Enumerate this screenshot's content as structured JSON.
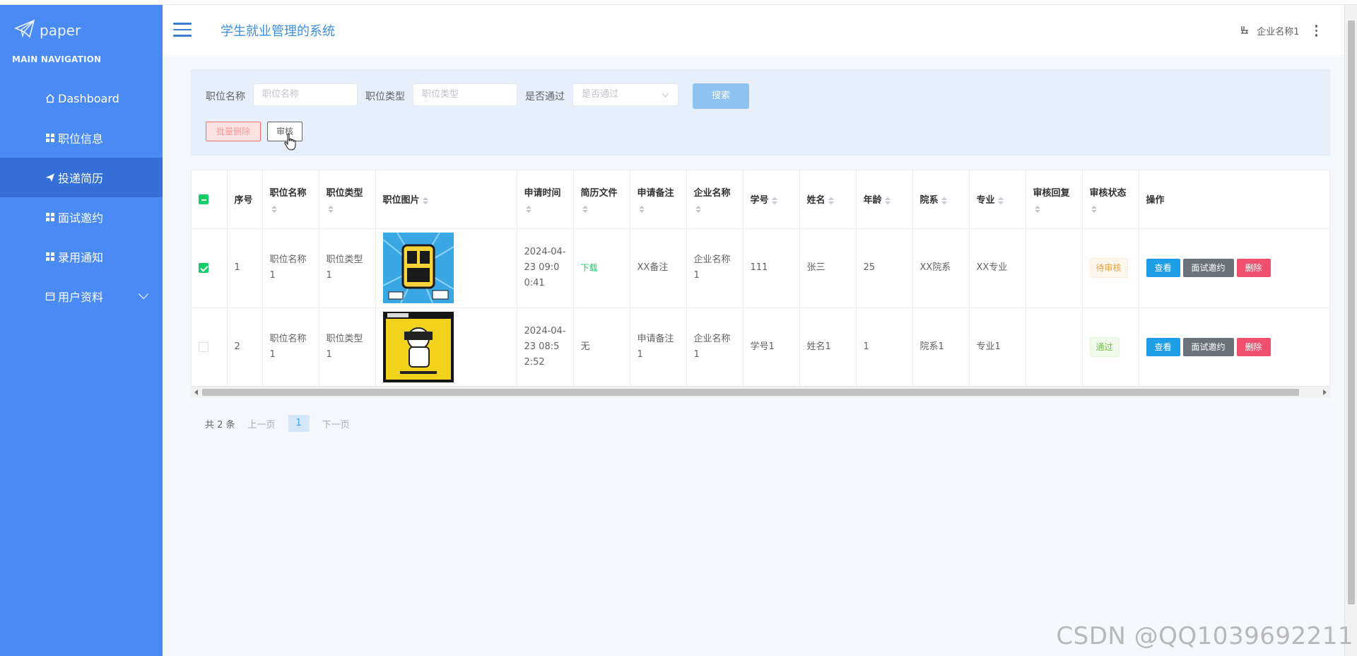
{
  "sidebar": {
    "logo_text": "paper",
    "section_title": "MAIN NAVIGATION",
    "items": [
      {
        "label": "Dashboard",
        "icon": "home-icon"
      },
      {
        "label": "职位信息",
        "icon": "grid-icon"
      },
      {
        "label": "投递简历",
        "icon": "send-icon",
        "active": true
      },
      {
        "label": "面试邀约",
        "icon": "grid-icon"
      },
      {
        "label": "录用通知",
        "icon": "grid-icon"
      },
      {
        "label": "用户资料",
        "icon": "calendar-icon"
      }
    ]
  },
  "header": {
    "title": "学生就业管理的系统",
    "user_name": "企业名称1"
  },
  "search": {
    "fields": [
      {
        "label": "职位名称",
        "placeholder": "职位名称"
      },
      {
        "label": "职位类型",
        "placeholder": "职位类型"
      },
      {
        "label": "是否通过",
        "placeholder": "是否通过"
      }
    ],
    "search_button": "搜索",
    "bulk_delete_button": "批量删除",
    "audit_button": "审核"
  },
  "table": {
    "columns": [
      "序号",
      "职位名称",
      "职位类型",
      "职位图片",
      "申请时间",
      "简历文件",
      "申请备注",
      "企业名称",
      "学号",
      "姓名",
      "年龄",
      "院系",
      "专业",
      "审核回复",
      "审核状态",
      "操作"
    ],
    "rows": [
      {
        "checked": true,
        "index": "1",
        "job_name": "职位名称1",
        "job_type": "职位类型1",
        "image": "recruit-poster-blue",
        "apply_time": "2024-04-23 09:00:41",
        "resume": "下载",
        "remark": "XX备注",
        "company": "企业名称1",
        "student_id": "111",
        "name": "张三",
        "age": "25",
        "department": "XX院系",
        "major": "XX专业",
        "reply": "",
        "status": "待审核"
      },
      {
        "checked": false,
        "index": "2",
        "job_name": "职位名称1",
        "job_type": "职位类型1",
        "image": "recruit-poster-yellow",
        "apply_time": "2024-04-23 08:52:52",
        "resume": "无",
        "remark": "申请备注1",
        "company": "企业名称1",
        "student_id": "学号1",
        "name": "姓名1",
        "age": "1",
        "department": "院系1",
        "major": "专业1",
        "reply": "",
        "status": "通过"
      }
    ],
    "actions": {
      "view": "查看",
      "invite": "面试邀约",
      "delete": "删除"
    }
  },
  "pagination": {
    "total_text": "共 2 条",
    "prev": "上一页",
    "current": "1",
    "next": "下一页"
  },
  "watermark": "CSDN @QQ1039692211",
  "colors": {
    "sidebar": "#4a8af4",
    "sidebar_active": "#3470d8",
    "primary_text": "#3a8ee6",
    "view_button": "#1e9ee6",
    "invite_button": "#6c7279",
    "delete_button": "#f0506e",
    "checkbox": "#13ce66"
  }
}
